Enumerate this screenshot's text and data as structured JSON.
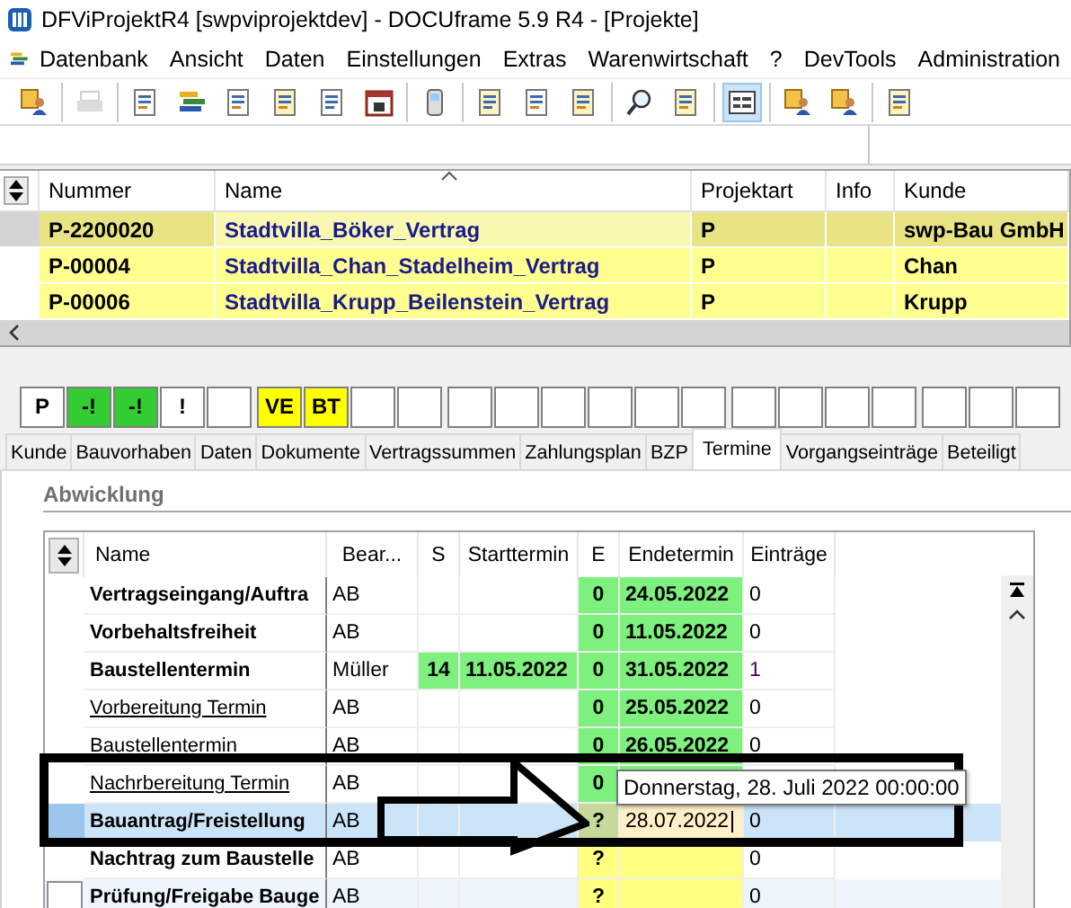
{
  "window": {
    "title": "DFViProjektR4 [swpviprojektdev] - DOCUframe 5.9 R4 - [Projekte]"
  },
  "menu": [
    "Datenbank",
    "Ansicht",
    "Daten",
    "Einstellungen",
    "Extras",
    "Warenwirtschaft",
    "?",
    "DevTools",
    "Administration"
  ],
  "toolbar": [
    [
      {
        "disabled": false,
        "selected": false
      }
    ],
    [
      {
        "disabled": true,
        "selected": false
      }
    ],
    [
      {
        "disabled": false,
        "selected": false
      },
      {
        "disabled": false,
        "selected": false
      },
      {
        "disabled": false,
        "selected": false
      },
      {
        "disabled": false,
        "selected": false
      },
      {
        "disabled": false,
        "selected": false
      },
      {
        "disabled": false,
        "selected": false
      }
    ],
    [
      {
        "disabled": false,
        "selected": false
      }
    ],
    [
      {
        "disabled": false,
        "selected": false
      },
      {
        "disabled": false,
        "selected": false
      },
      {
        "disabled": false,
        "selected": false
      }
    ],
    [
      {
        "disabled": false,
        "selected": false
      },
      {
        "disabled": false,
        "selected": false
      }
    ],
    [
      {
        "disabled": false,
        "selected": true
      }
    ],
    [
      {
        "disabled": false,
        "selected": false
      },
      {
        "disabled": false,
        "selected": false
      }
    ],
    [
      {
        "disabled": false,
        "selected": false
      }
    ]
  ],
  "projects": {
    "columns": [
      "Nummer",
      "Name",
      "Projektart",
      "Info",
      "Kunde"
    ],
    "rows": [
      {
        "selected": true,
        "cells": [
          "P-2200020",
          "Stadtvilla_Böker_Vertrag",
          "P",
          "",
          "swp-Bau GmbH"
        ]
      },
      {
        "selected": false,
        "cells": [
          "P-00004",
          "Stadtvilla_Chan_Stadelheim_Vertrag",
          "P",
          "",
          "Chan"
        ]
      },
      {
        "selected": false,
        "cells": [
          "P-00006",
          "Stadtvilla_Krupp_Beilenstein_Vertrag",
          "P",
          "",
          "Krupp"
        ]
      }
    ]
  },
  "status_boxes": [
    [
      {
        "label": "P",
        "color": "#ffffff"
      },
      {
        "label": "-!",
        "color": "#33cc33"
      },
      {
        "label": "-!",
        "color": "#33cc33"
      },
      {
        "label": "!",
        "color": "#ffffff"
      },
      {
        "color": "#ffffff"
      }
    ],
    [
      {
        "label": "VE",
        "color": "#ffff00"
      },
      {
        "label": "BT",
        "color": "#ffff00"
      },
      {
        "color": "#ffffff"
      },
      {
        "color": "#ffffff"
      }
    ],
    [
      {
        "color": "#ffffff"
      },
      {
        "color": "#ffffff"
      },
      {
        "color": "#ffffff"
      },
      {
        "color": "#ffffff"
      },
      {
        "color": "#ffffff"
      },
      {
        "color": "#ffffff"
      }
    ],
    [
      {
        "color": "#ffffff"
      },
      {
        "color": "#ffffff"
      },
      {
        "color": "#ffffff"
      },
      {
        "color": "#ffffff"
      }
    ],
    [
      {
        "color": "#ffffff"
      },
      {
        "color": "#ffffff"
      },
      {
        "color": "#ffffff"
      }
    ]
  ],
  "tabs": [
    {
      "label": "Kunde",
      "selected": false
    },
    {
      "label": "Bauvorhaben",
      "selected": false
    },
    {
      "label": "Daten",
      "selected": false
    },
    {
      "label": "Dokumente",
      "selected": false
    },
    {
      "label": "Vertragssummen",
      "selected": false
    },
    {
      "label": "Zahlungsplan",
      "selected": false
    },
    {
      "label": "BZP",
      "selected": false
    },
    {
      "label": "Termine",
      "selected": true
    },
    {
      "label": "Vorgangseinträge",
      "selected": false
    },
    {
      "label": "Beteiligt",
      "selected": false
    }
  ],
  "section": {
    "title": "Abwicklung"
  },
  "schedule": {
    "columns": [
      "Name",
      "Bear...",
      "S",
      "Starttermin",
      "E",
      "Endetermin",
      "Einträge"
    ],
    "rows": [
      {
        "name": "Vertragseingang/Auftra",
        "kind": "bold",
        "bearbeiter": "AB",
        "done": true,
        "editing": false,
        "e": "0",
        "end": "24.05.2022",
        "entries": "0",
        "selected": false,
        "focused": false
      },
      {
        "name": "Vorbehaltsfreiheit",
        "kind": "bold",
        "bearbeiter": "AB",
        "done": true,
        "editing": false,
        "e": "0",
        "end": "11.05.2022",
        "entries": "0",
        "selected": false,
        "focused": false
      },
      {
        "name": "Baustellentermin",
        "kind": "bold",
        "bearbeiter": "Müller",
        "s": "14",
        "start": "11.05.2022",
        "done": true,
        "editing": false,
        "e": "0",
        "end": "31.05.2022",
        "entries": "1",
        "selected": false,
        "focused": false
      },
      {
        "name": "Vorbereitung Termin",
        "kind": "link",
        "bearbeiter": "AB",
        "done": true,
        "editing": false,
        "e": "0",
        "end": "25.05.2022",
        "entries": "0",
        "selected": false,
        "focused": false
      },
      {
        "name": "Baustellentermin",
        "kind": "plain",
        "bearbeiter": "AB",
        "done": true,
        "editing": false,
        "e": "0",
        "end": "26.05.2022",
        "entries": "0",
        "selected": false,
        "focused": false
      },
      {
        "name": "Nachrbereitung Termin",
        "kind": "link",
        "bearbeiter": "AB",
        "done": true,
        "editing": false,
        "e": "0",
        "selected": false,
        "focused": false
      },
      {
        "name": "Bauantrag/Freistellung",
        "kind": "bold",
        "bearbeiter": "AB",
        "done": false,
        "editing": true,
        "e": "?",
        "end": "28.07.2022",
        "entries": "0",
        "selected": true,
        "focused": false
      },
      {
        "name": "Nachtrag zum Baustelle",
        "kind": "bold",
        "bearbeiter": "AB",
        "done": false,
        "editing": false,
        "e": "?",
        "entries": "0",
        "selected": false,
        "focused": false
      },
      {
        "name": "Prüfung/Freigabe Bauge",
        "kind": "bold",
        "bearbeiter": "AB",
        "done": false,
        "editing": false,
        "e": "?",
        "entries": "0",
        "selected": false,
        "focused": true
      }
    ]
  },
  "tooltip": "Donnerstag, 28. Juli 2022 00:00:00"
}
